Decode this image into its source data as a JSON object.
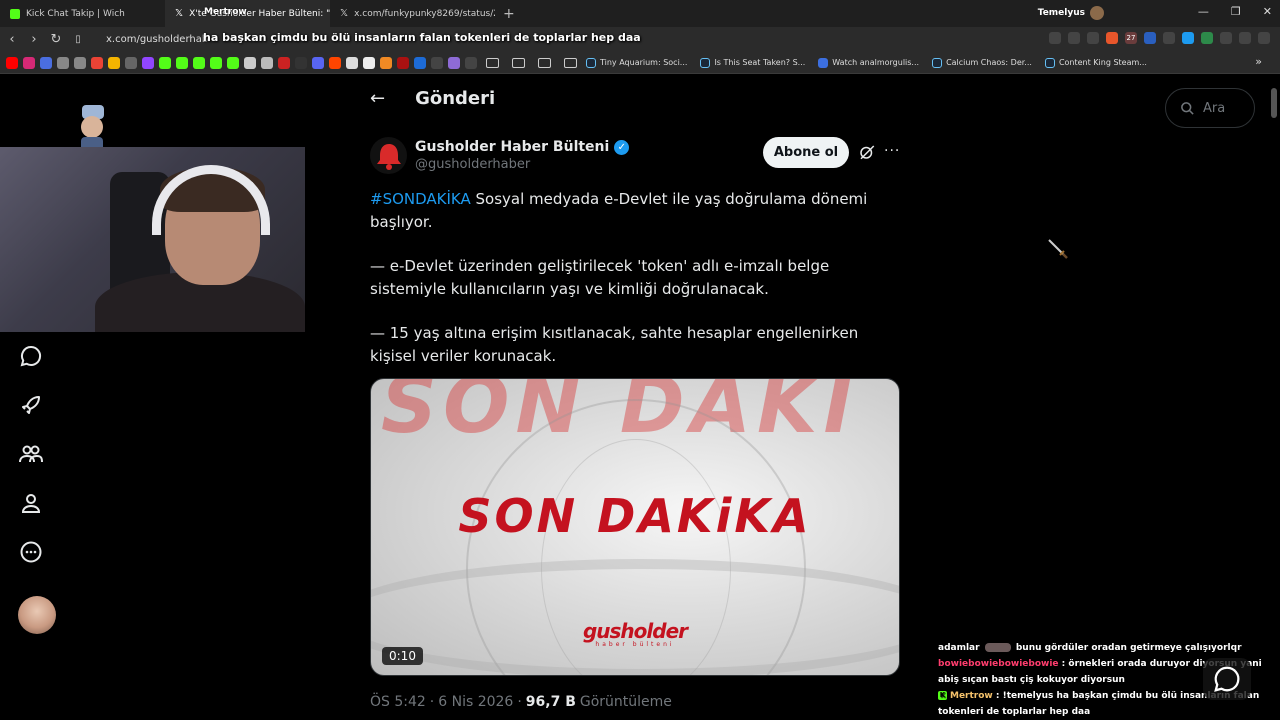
{
  "browser": {
    "tabs": [
      {
        "label": "Kick Chat Takip | Wich",
        "active": false
      },
      {
        "label": "X'te Gusholder Haber Bülteni: \"#",
        "active": true
      },
      {
        "label": "x.com/funkypunky8269/status/2040",
        "active": false
      }
    ],
    "tab_overlay": "Mertrow",
    "profile_name": "Temelyus",
    "url": "x.com/gusholderhab",
    "overlay_message": "ha başkan çimdu bu ölü insanların falan tokenleri de toplarlar hep daa",
    "extension_badge": "27",
    "bookmarks": [
      {
        "label": "Tiny Aquarium: Soci..."
      },
      {
        "label": "Is This Seat Taken? S..."
      },
      {
        "label": "Watch analmorgulis..."
      },
      {
        "label": "Calcium Chaos: Der..."
      },
      {
        "label": "Content King Steam..."
      }
    ]
  },
  "page": {
    "title": "Gönderi",
    "search_placeholder": "Ara"
  },
  "tweet": {
    "author_name": "Gusholder Haber Bülteni",
    "author_handle": "@gusholderhaber",
    "subscribe_label": "Abone ol",
    "hashtag": "#SONDAKİKA",
    "line1": " Sosyal medyada e-Devlet ile yaş doğrulama dönemi başlıyor.",
    "para2": "— e-Devlet üzerinden geliştirilecek 'token' adlı e-imzalı belge sistemiyle kullanıcıların yaşı ve kimliği doğrulanacak.",
    "para3": "— 15 yaş altına erişim kısıtlanacak, sahte hesaplar engellenirken kişisel veriler korunacak.",
    "media": {
      "bg_text": "SON DAKİ",
      "headline": "SON DAKiKA",
      "brand": "gusholder",
      "brand_sub": "haber bülteni",
      "duration": "0:10"
    },
    "time": "ÖS 5:42",
    "sep1": "·",
    "date": "6 Nis 2026",
    "sep2": "·",
    "views": "96,7 B",
    "views_label": "Görüntüleme"
  },
  "chat": [
    {
      "user": "adamlar",
      "message": "bunu gördüler oradan getirmeye çalışıyorlqr"
    },
    {
      "user": "bowiebowiebowiebowie",
      "message": ": örnekleri orada duruyor diyorsun yani abiş sıçan bastı çiş kokuyor diyorsun"
    },
    {
      "user": "Mertrow",
      "message": ": !temelyus ha başkan çimdu bu ölü insanların falan tokenleri de toplarlar hep daa"
    }
  ],
  "colors": {
    "accent": "#1d9bf0",
    "background": "#000000",
    "breaking_red": "#c4121f"
  }
}
